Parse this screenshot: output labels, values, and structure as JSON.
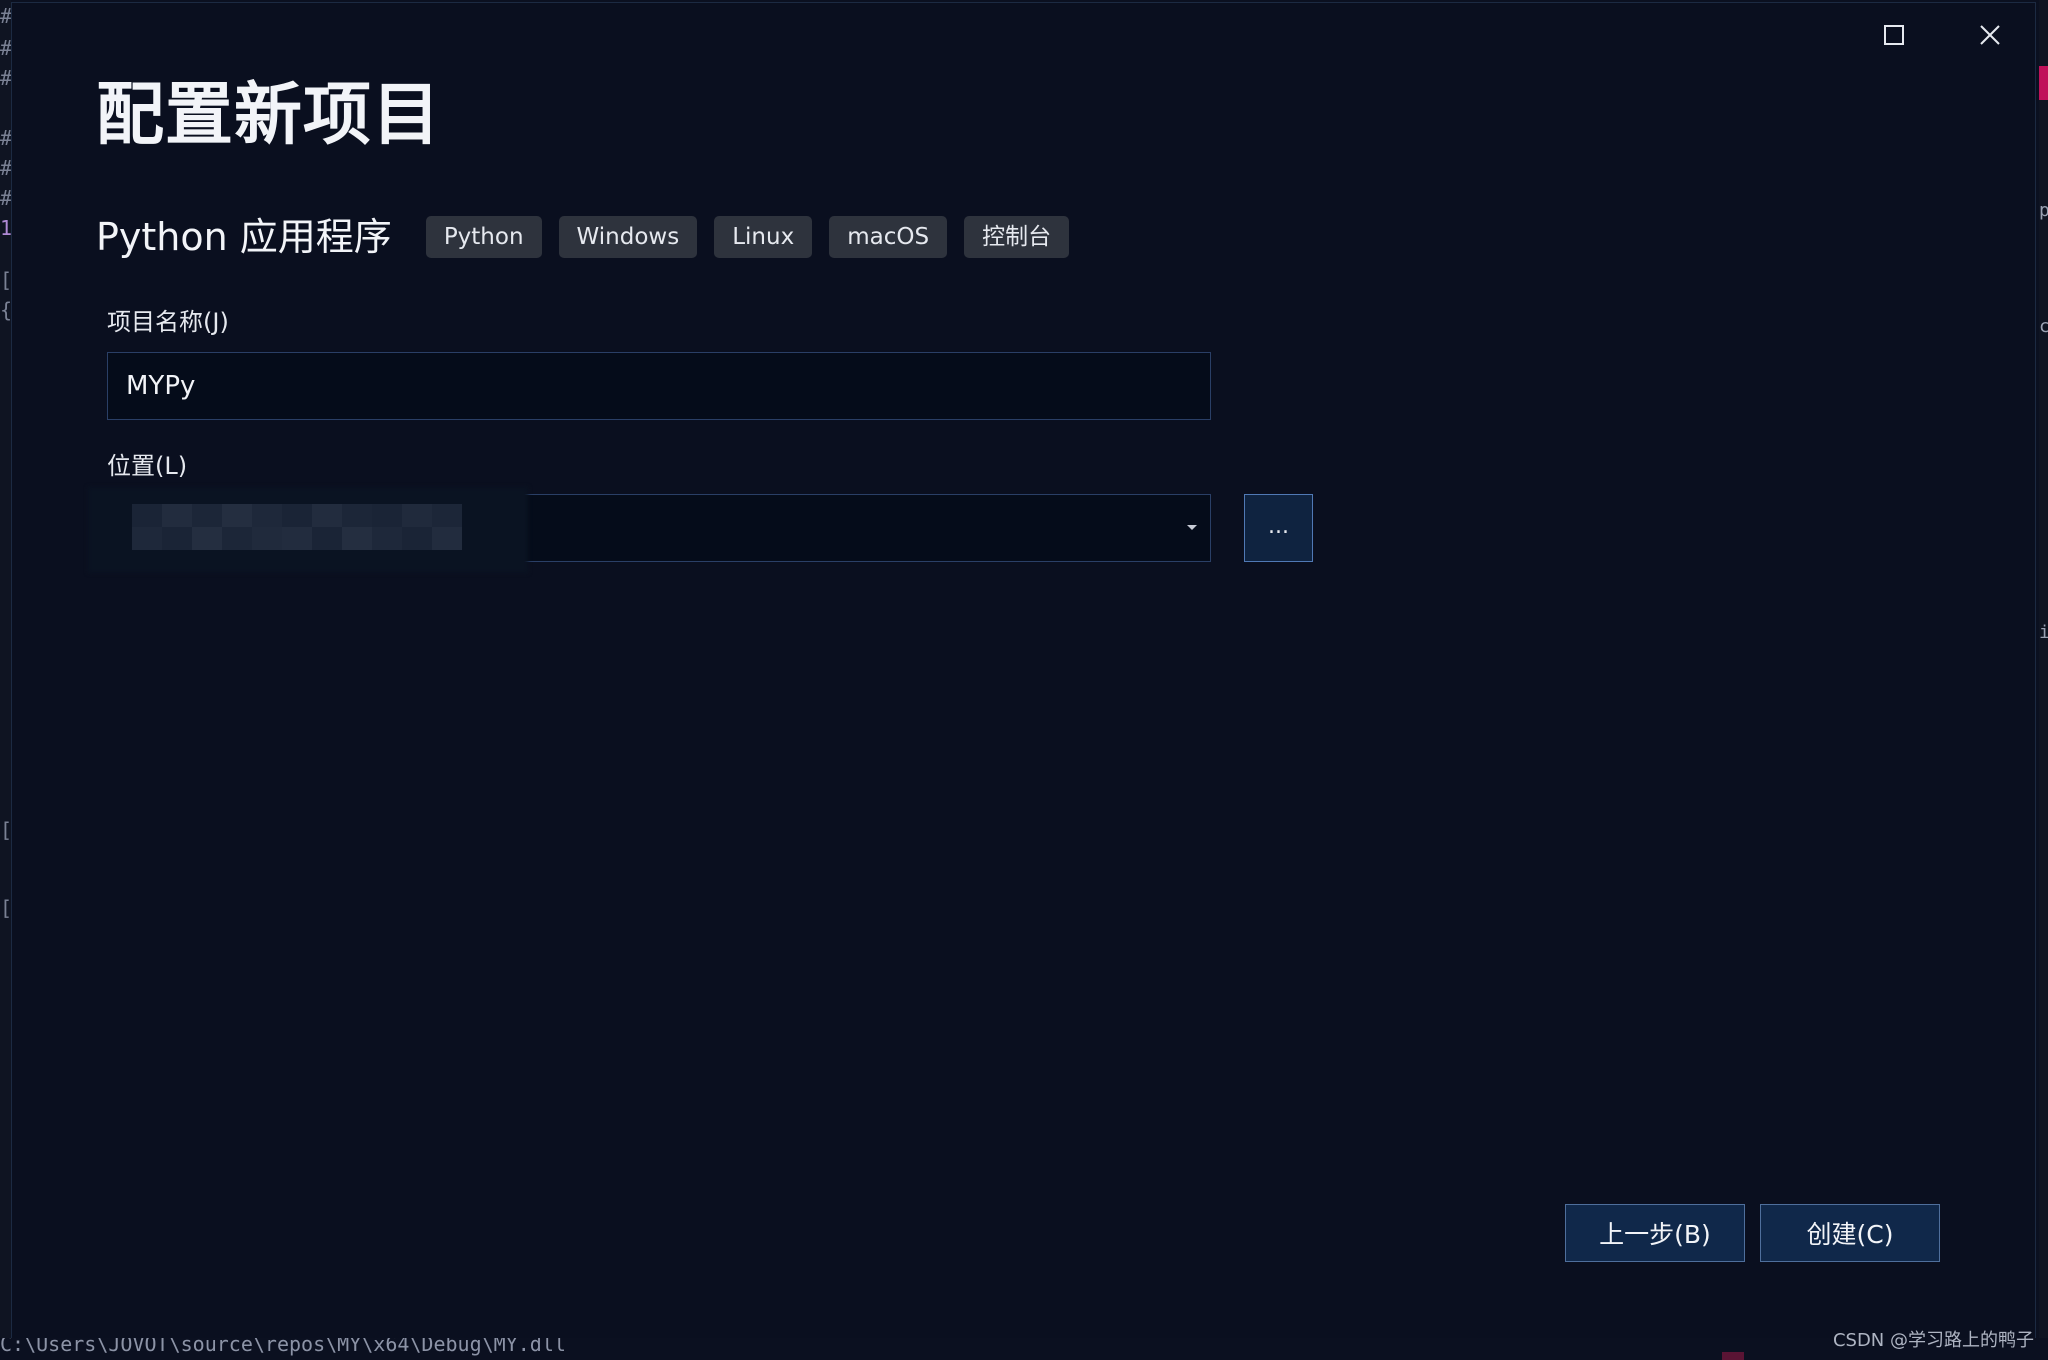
{
  "dialog": {
    "title": "配置新项目",
    "template_name": "Python 应用程序",
    "tags": [
      "Python",
      "Windows",
      "Linux",
      "macOS",
      "控制台"
    ]
  },
  "project_name": {
    "label": "项目名称(J)",
    "value": "MYPy"
  },
  "location": {
    "label": "位置(L)",
    "browse_label": "..."
  },
  "buttons": {
    "back": "上一步(B)",
    "create": "创建(C)"
  },
  "background": {
    "bottom_path": "C:\\Users\\JOVOT\\source\\repos\\MY\\x64\\Debug\\MY.dll"
  },
  "watermark": "CSDN @学习路上的鸭子",
  "colors": {
    "dialog_bg": "#0a0f1f",
    "input_bg": "#050c1a",
    "button_bg": "#10284a",
    "tag_bg": "#2e333d"
  }
}
